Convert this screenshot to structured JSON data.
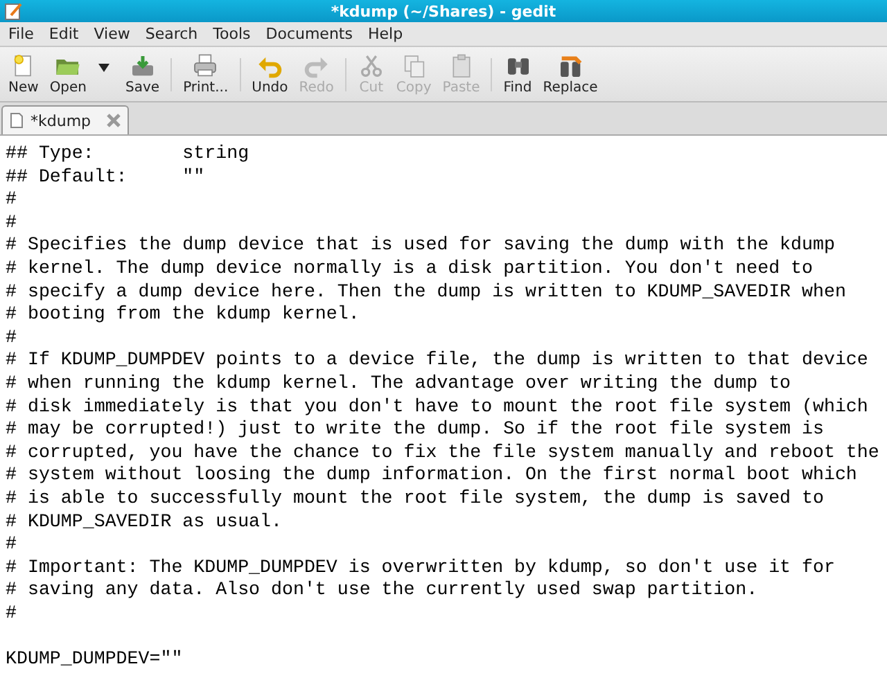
{
  "window": {
    "title": "*kdump (~/Shares) - gedit"
  },
  "menu": [
    "File",
    "Edit",
    "View",
    "Search",
    "Tools",
    "Documents",
    "Help"
  ],
  "toolbar": [
    {
      "kind": "new",
      "label": "New",
      "disabled": false
    },
    {
      "kind": "open",
      "label": "Open",
      "disabled": false
    },
    {
      "kind": "dropdown"
    },
    {
      "kind": "save",
      "label": "Save",
      "disabled": false
    },
    {
      "kind": "separator"
    },
    {
      "kind": "print",
      "label": "Print...",
      "disabled": false
    },
    {
      "kind": "separator"
    },
    {
      "kind": "undo",
      "label": "Undo",
      "disabled": false
    },
    {
      "kind": "redo",
      "label": "Redo",
      "disabled": true
    },
    {
      "kind": "separator"
    },
    {
      "kind": "cut",
      "label": "Cut",
      "disabled": true
    },
    {
      "kind": "copy",
      "label": "Copy",
      "disabled": true
    },
    {
      "kind": "paste",
      "label": "Paste",
      "disabled": true
    },
    {
      "kind": "separator"
    },
    {
      "kind": "find",
      "label": "Find",
      "disabled": false
    },
    {
      "kind": "replace",
      "label": "Replace",
      "disabled": false
    }
  ],
  "tabs": [
    {
      "label": "*kdump",
      "selected": true
    }
  ],
  "editor": {
    "lines": [
      {
        "text": "## Type:        string"
      },
      {
        "text": "## Default:     \"\""
      },
      {
        "text": "#"
      },
      {
        "text": "#"
      },
      {
        "text": "# Specifies the dump device that is used for saving the dump with the kdump"
      },
      {
        "text": "# kernel. The dump device normally is a disk partition. You don't need to"
      },
      {
        "text": "# specify a dump device here. Then the dump is written to KDUMP_SAVEDIR when"
      },
      {
        "text": "# booting from the kdump kernel."
      },
      {
        "text": "#"
      },
      {
        "text": "# If KDUMP_DUMPDEV points to a device file, the dump is written to that device"
      },
      {
        "text": "# when running the kdump kernel. The advantage over writing the dump to"
      },
      {
        "text": "# disk immediately is that you don't have to mount the root file system (which"
      },
      {
        "text": "# may be corrupted!) just to write the dump. So if the root file system is"
      },
      {
        "text": "# corrupted, you have the chance to fix the file system manually and reboot the"
      },
      {
        "text": "# system without loosing the dump information. On the first normal boot which"
      },
      {
        "text": "# is able to successfully mount the root file system, the dump is saved to"
      },
      {
        "text": "# KDUMP_SAVEDIR as usual."
      },
      {
        "text": "#"
      },
      {
        "text": "# Important: The KDUMP_DUMPDEV is overwritten by kdump, so don't use it for"
      },
      {
        "text": "# saving any data. Also don't use the currently used swap partition."
      },
      {
        "text": "#"
      },
      {
        "text": "KDUMP_DUMPDEV=\"\"",
        "gap_before": true
      }
    ]
  }
}
